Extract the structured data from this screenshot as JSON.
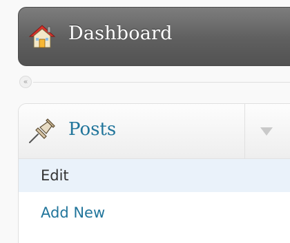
{
  "menu": {
    "dashboard": {
      "label": "Dashboard",
      "icon": "house-icon"
    },
    "collapse": {
      "icon": "collapse-icon",
      "glyph": "«"
    },
    "posts": {
      "label": "Posts",
      "icon": "pushpin-icon",
      "toggle_icon": "chevron-down-icon",
      "submenu": [
        {
          "label": "Edit",
          "current": true
        },
        {
          "label": "Add New",
          "current": false
        }
      ]
    }
  },
  "colors": {
    "link": "#21759b",
    "current_bg": "#eaf2fa",
    "dashboard_bg": "#606060",
    "text_dark": "#333333"
  }
}
